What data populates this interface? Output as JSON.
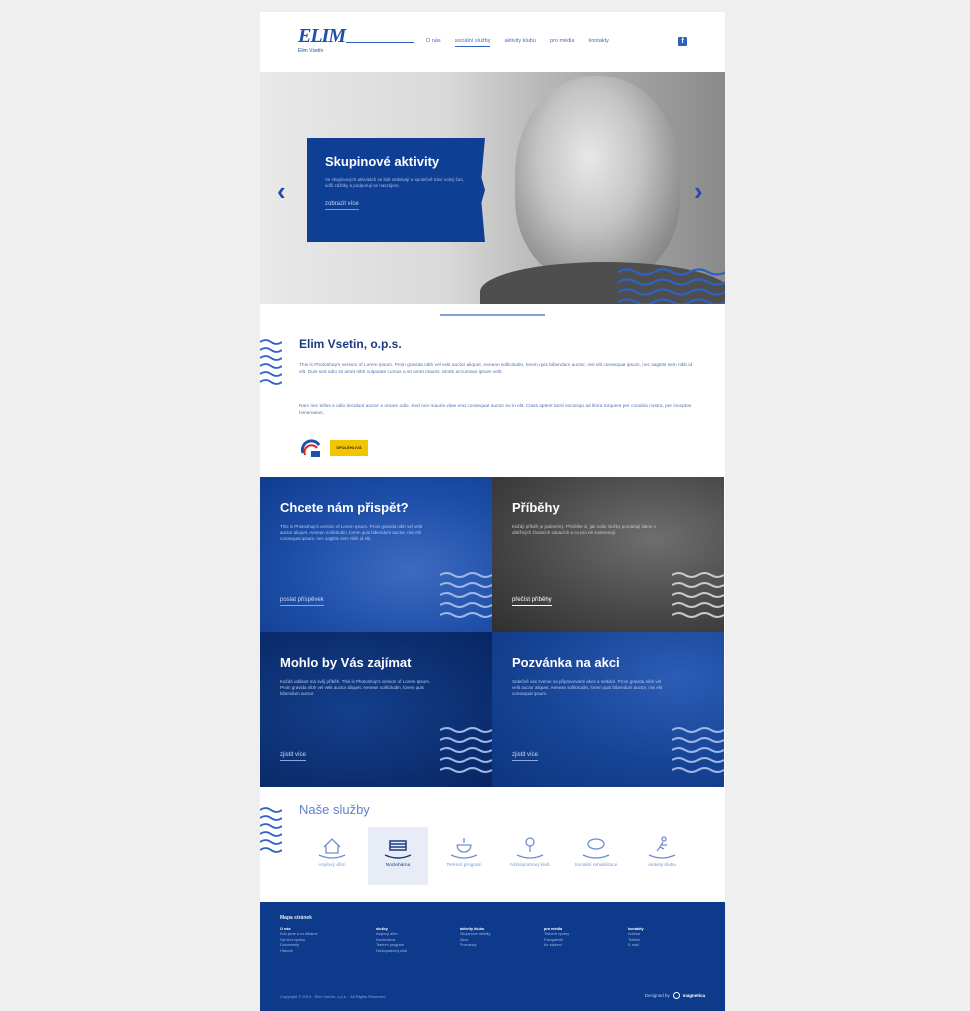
{
  "header": {
    "logo_text": "ELIM",
    "logo_sub": "Elim Vsetín",
    "nav": [
      "O nás",
      "sociální služby",
      "aktivity klubu",
      "pro média",
      "kontakty"
    ],
    "active_nav_index": 1,
    "social_icon": "facebook-icon"
  },
  "hero": {
    "title": "Skupinové aktivity",
    "text": "Ve skupinových aktivitách se lidé setkávají a společně tráví volný čas, sdílí zážitky a podporují se navzájem.",
    "link": "zobrazit více",
    "prev_icon": "chevron-left-icon",
    "next_icon": "chevron-right-icon"
  },
  "about": {
    "title": "Elim Vsetin, o.p.s.",
    "p1": "This is Photoshop's version of Lorem Ipsum. Proin gravida nibh vel velit auctor aliquet. Aenean sollicitudin, lorem quis bibendum auctor, nisi elit consequat ipsum, nec sagittis sem nibh id elit. Duis sed odio sit amet nibh vulputate cursus a sit amet mauris. Morbi accumsan ipsum velit.",
    "p2": "Nam nec tellus a odio tincidunt auctor a ornare odio. Sed non mauris vitae erat consequat auctor eu in elit. Class aptent taciti sociosqu ad litora torquent per conubia nostra, per inceptos himenaeos.",
    "badge_text": "SPOLEHLIVÁ"
  },
  "cards": [
    {
      "title": "Chcete nám přispět?",
      "text": "This is Photoshop's version of Lorem Ipsum. Proin gravida nibh vel velit auctor aliquet. Aenean sollicitudin, lorem quis bibendum auctor, nisi elit consequat ipsum, nec sagittis sem nibh id elit.",
      "link": "poslat příspěvek"
    },
    {
      "title": "Příběhy",
      "text": "Každý příběh je jedinečný. Přečtěte si, jak naše služby pomáhají lidem v obtížných životních situacích a co pro ně znamenají.",
      "link": "přečíst příběhy"
    },
    {
      "title": "Mohlo by Vás zajímat",
      "text": "Každá událost má svůj příběh. This is Photoshop's version of Lorem Ipsum. Proin gravida nibh vel velit auctor aliquet. Aenean sollicitudin, lorem quis bibendum auctor.",
      "link": "zjistit více"
    },
    {
      "title": "Pozvánka na akci",
      "text": "Srdečně vás zveme na připravované akce a setkání. Proin gravida nibh vel velit auctor aliquet. Aenean sollicitudin, lorem quis bibendum auctor, nisi elit consequat ipsum.",
      "link": "zjistit více"
    }
  ],
  "services": {
    "title": "Naše služby",
    "items": [
      {
        "label": "Azylový dům",
        "icon": "house-icon"
      },
      {
        "label": "Noclehárna",
        "icon": "bed-icon"
      },
      {
        "label": "Terénní program",
        "icon": "bowl-icon"
      },
      {
        "label": "Nízkoprahový klub",
        "icon": "person-icon"
      },
      {
        "label": "Sociální rehabilitace",
        "icon": "speech-bubble-icon"
      },
      {
        "label": "Aktivity klubu",
        "icon": "runner-icon"
      }
    ],
    "active_index": 1
  },
  "footer": {
    "title": "Mapa stránek",
    "columns": [
      {
        "heading": "O nás",
        "items": [
          "Kdo jsme a co děláme",
          "Výroční zprávy",
          "Dokumenty",
          "Historie"
        ]
      },
      {
        "heading": "služby",
        "items": [
          "Azylový dům",
          "Noclehárna",
          "Terénní program",
          "Nízkoprahový klub"
        ]
      },
      {
        "heading": "aktivity klubu",
        "items": [
          "Skupinové aktivity",
          "Akce",
          "Pozvánky"
        ]
      },
      {
        "heading": "pro média",
        "items": [
          "Tiskové zprávy",
          "Fotogalerie",
          "Ke stažení"
        ]
      },
      {
        "heading": "kontakty",
        "items": [
          "Adresa",
          "Telefon",
          "E-mail"
        ]
      }
    ],
    "copyright": "Copyright © 2014 · Elim Vsetín, o.p.s. · All Rights Reserved",
    "designed_by": "Designed by",
    "designer": "magnetica"
  }
}
